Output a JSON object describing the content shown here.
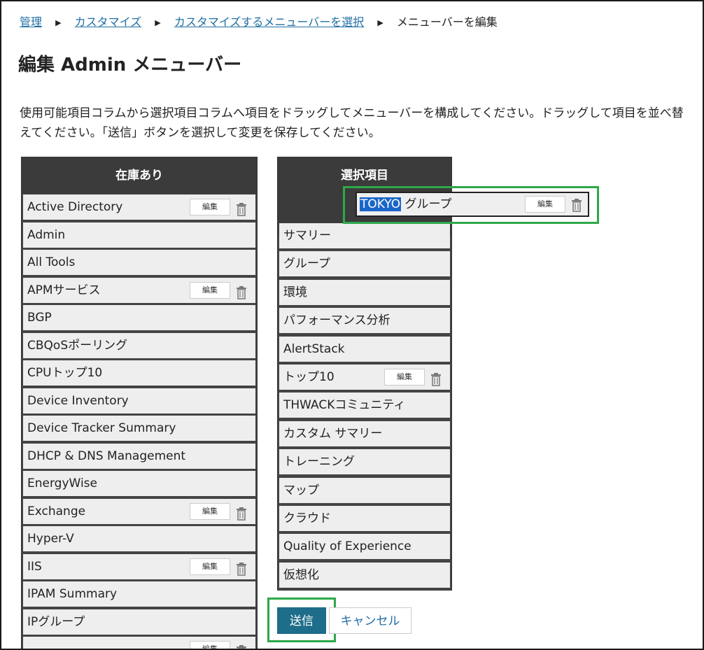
{
  "breadcrumb": {
    "items": [
      "管理",
      "カスタマイズ",
      "カスタマイズするメニューバーを選択"
    ],
    "current": "メニューバーを編集"
  },
  "page": {
    "title": "編集 Admin メニューバー",
    "description": "使用可能項目コラムから選択項目コラムへ項目をドラッグしてメニューバーを構成してください。ドラッグして項目を並べ替えてください。「送信」ボタンを選択して変更を保存してください。"
  },
  "available": {
    "header": "在庫あり",
    "items": [
      {
        "label": "Active Directory",
        "editable": true
      },
      {
        "label": "Admin",
        "editable": false
      },
      {
        "label": "All Tools",
        "editable": false
      },
      {
        "label": "APMサービス",
        "editable": true
      },
      {
        "label": "BGP",
        "editable": false
      },
      {
        "label": "CBQoSポーリング",
        "editable": false
      },
      {
        "label": "CPUトップ10",
        "editable": false
      },
      {
        "label": "Device Inventory",
        "editable": false
      },
      {
        "label": "Device Tracker Summary",
        "editable": false
      },
      {
        "label": "DHCP & DNS Management",
        "editable": false
      },
      {
        "label": "EnergyWise",
        "editable": false
      },
      {
        "label": "Exchange",
        "editable": true
      },
      {
        "label": "Hyper-V",
        "editable": false
      },
      {
        "label": "IIS",
        "editable": true
      },
      {
        "label": "IPAM Summary",
        "editable": false
      },
      {
        "label": "IPグループ",
        "editable": false
      },
      {
        "label": "",
        "editable": true
      }
    ]
  },
  "selected": {
    "header": "選択項目",
    "items": [
      {
        "label": "サマリー",
        "editable": false
      },
      {
        "label": "グループ",
        "editable": false
      },
      {
        "label": "環境",
        "editable": false
      },
      {
        "label": "パフォーマンス分析",
        "editable": false
      },
      {
        "label": "AlertStack",
        "editable": false
      },
      {
        "label": "トップ10",
        "editable": true
      },
      {
        "label": "THWACKコミュニティ",
        "editable": false
      },
      {
        "label": "カスタム サマリー",
        "editable": false
      },
      {
        "label": "トレーニング",
        "editable": false
      },
      {
        "label": "マップ",
        "editable": false
      },
      {
        "label": "クラウド",
        "editable": false
      },
      {
        "label": "Quality of Experience",
        "editable": false
      },
      {
        "label": "仮想化",
        "editable": false
      }
    ]
  },
  "dragging": {
    "highlight": "TOKYO",
    "rest": " グループ"
  },
  "labels": {
    "edit": "編集"
  },
  "buttons": {
    "submit": "送信",
    "cancel": "キャンセル"
  },
  "colors": {
    "header_bg": "#3b3b3b",
    "item_bg": "#eeeeee",
    "link": "#1f6fa3",
    "submit_bg": "#1e6d8a",
    "highlight_box": "#2ea84a",
    "selection": "#1a66c9"
  },
  "icons": {
    "separator": "triangle-right-icon",
    "delete": "trash-icon"
  }
}
